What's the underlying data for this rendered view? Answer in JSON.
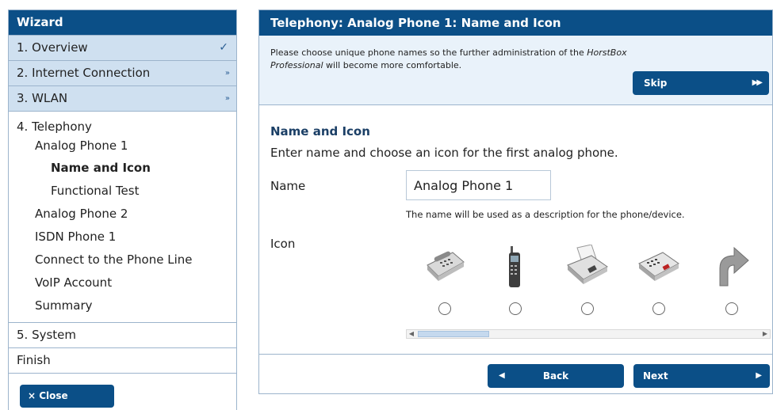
{
  "sidebar": {
    "title": "Wizard",
    "steps": [
      {
        "label": "1. Overview",
        "mark": "✓"
      },
      {
        "label": "2. Internet Connection",
        "mark": "»"
      },
      {
        "label": "3. WLAN",
        "mark": "»"
      }
    ],
    "telephony": {
      "label": "4. Telephony",
      "phone1": "Analog Phone 1",
      "phone1_sub": [
        "Name and Icon",
        "Functional Test"
      ],
      "items": [
        "Analog Phone 2",
        "ISDN Phone 1",
        "Connect to the Phone Line",
        "VoIP Account",
        "Summary"
      ]
    },
    "system": "5. System",
    "finish": "Finish",
    "close_label": "× Close"
  },
  "main": {
    "header": "Telephony: Analog Phone 1: Name and Icon",
    "info_prefix": "Please choose unique phone names so the further administration of the ",
    "info_product": "HorstBox Professional",
    "info_suffix": " will become more comfortable.",
    "skip_label": "Skip",
    "section_title": "Name and Icon",
    "section_desc": "Enter name and choose an icon for the first analog phone.",
    "name_label": "Name",
    "name_value": "Analog Phone 1",
    "name_hint": "The name will be used as a description for the phone/device.",
    "icon_label": "Icon",
    "icons": [
      "desk-phone-icon",
      "cordless-phone-icon",
      "fax-machine-icon",
      "answering-machine-icon",
      "forward-arrow-icon"
    ],
    "back_label": "Back",
    "next_label": "Next"
  },
  "colors": {
    "header_blue": "#0b4f87",
    "sidebar_item_bg": "#cfe0f0",
    "info_bg": "#e9f2fa"
  }
}
